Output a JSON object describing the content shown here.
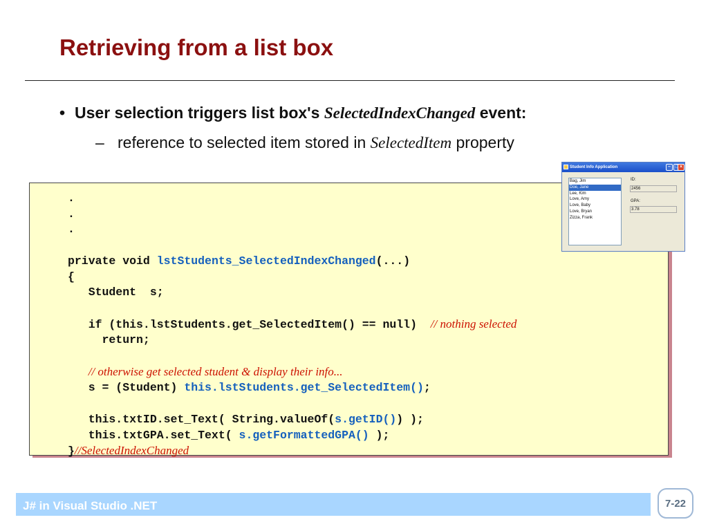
{
  "slide": {
    "title": "Retrieving from a list box",
    "bullet": {
      "symbol": "•",
      "prefix": "User selection triggers list box's ",
      "italic": "SelectedIndexChanged",
      "suffix": " event:"
    },
    "sub_bullet": {
      "symbol": "–",
      "prefix": "reference to selected item stored in ",
      "italic": "SelectedItem",
      "suffix": " property"
    }
  },
  "code": {
    "dots": [
      ".",
      ".",
      "."
    ],
    "sig_prefix": "private void ",
    "method_name": "lstStudents_SelectedIndexChanged",
    "sig_suffix": "(...)",
    "open_brace": "{",
    "decl": "   Student  s;",
    "if_line": "   if (this.lstStudents.get_SelectedItem() == null)",
    "if_comment": "// nothing selected",
    "return_line": "     return;",
    "comment2": "// otherwise get selected student & display their info...",
    "assign_prefix": "   s = (Student) ",
    "assign_call": "this.lstStudents.get_SelectedItem()",
    "assign_suffix": ";",
    "txtid_prefix": "   this.txtID.set_Text( String.valueOf(",
    "txtid_call": "s.getID()",
    "txtid_suffix": ") );",
    "txtgpa_prefix": "   this.txtGPA.set_Text( ",
    "txtgpa_call": "s.getFormattedGPA()",
    "txtgpa_suffix": " );",
    "close_brace": "}",
    "close_comment": "//SelectedIndexChanged"
  },
  "app_window": {
    "title": "Student Info Application",
    "students": [
      "Bag, Jim",
      "Doe, Jane",
      "Lee, Kim",
      "Love, Amy",
      "Love, Baby",
      "Love, Bryan",
      "Zizza, Frank"
    ],
    "selected": "Doe, Jane",
    "id_label": "ID:",
    "id_value": "2456",
    "gpa_label": "GPA:",
    "gpa_value": "3.78"
  },
  "footer": {
    "text": "J# in Visual Studio .NET",
    "page": "7-22"
  },
  "colors": {
    "title": "#8b1010",
    "code_background": "#ffffcc",
    "code_keyword": "#1560bd",
    "code_comment": "#cc1100",
    "footer_bar": "#a9d6ff"
  }
}
